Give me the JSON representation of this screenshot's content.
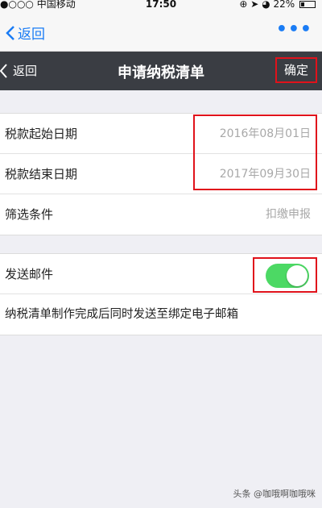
{
  "status_bar": {
    "carrier": "●○○○ 中国移动",
    "time": "17:50",
    "battery_text": "22%",
    "battery_level": 0.22
  },
  "outer_nav": {
    "back_label": "返回",
    "more_label": "•••"
  },
  "inner_nav": {
    "back_label": "返回",
    "title": "申请纳税清单",
    "confirm_label": "确定"
  },
  "form": {
    "start_date": {
      "label": "税款起始日期",
      "value": "2016年08月01日"
    },
    "end_date": {
      "label": "税款结束日期",
      "value": "2017年09月30日"
    },
    "filter": {
      "label": "筛选条件",
      "value": "扣缴申报"
    }
  },
  "email": {
    "label": "发送邮件",
    "enabled": true,
    "description": "纳税清单制作完成后同时发送至绑定电子邮箱"
  },
  "watermark": "头条 @咖哦啊咖哦咪",
  "colors": {
    "accent_blue": "#1a7cf5",
    "header_dark": "#3a3d43",
    "toggle_on": "#4cd964",
    "highlight_red": "#e0121b"
  }
}
